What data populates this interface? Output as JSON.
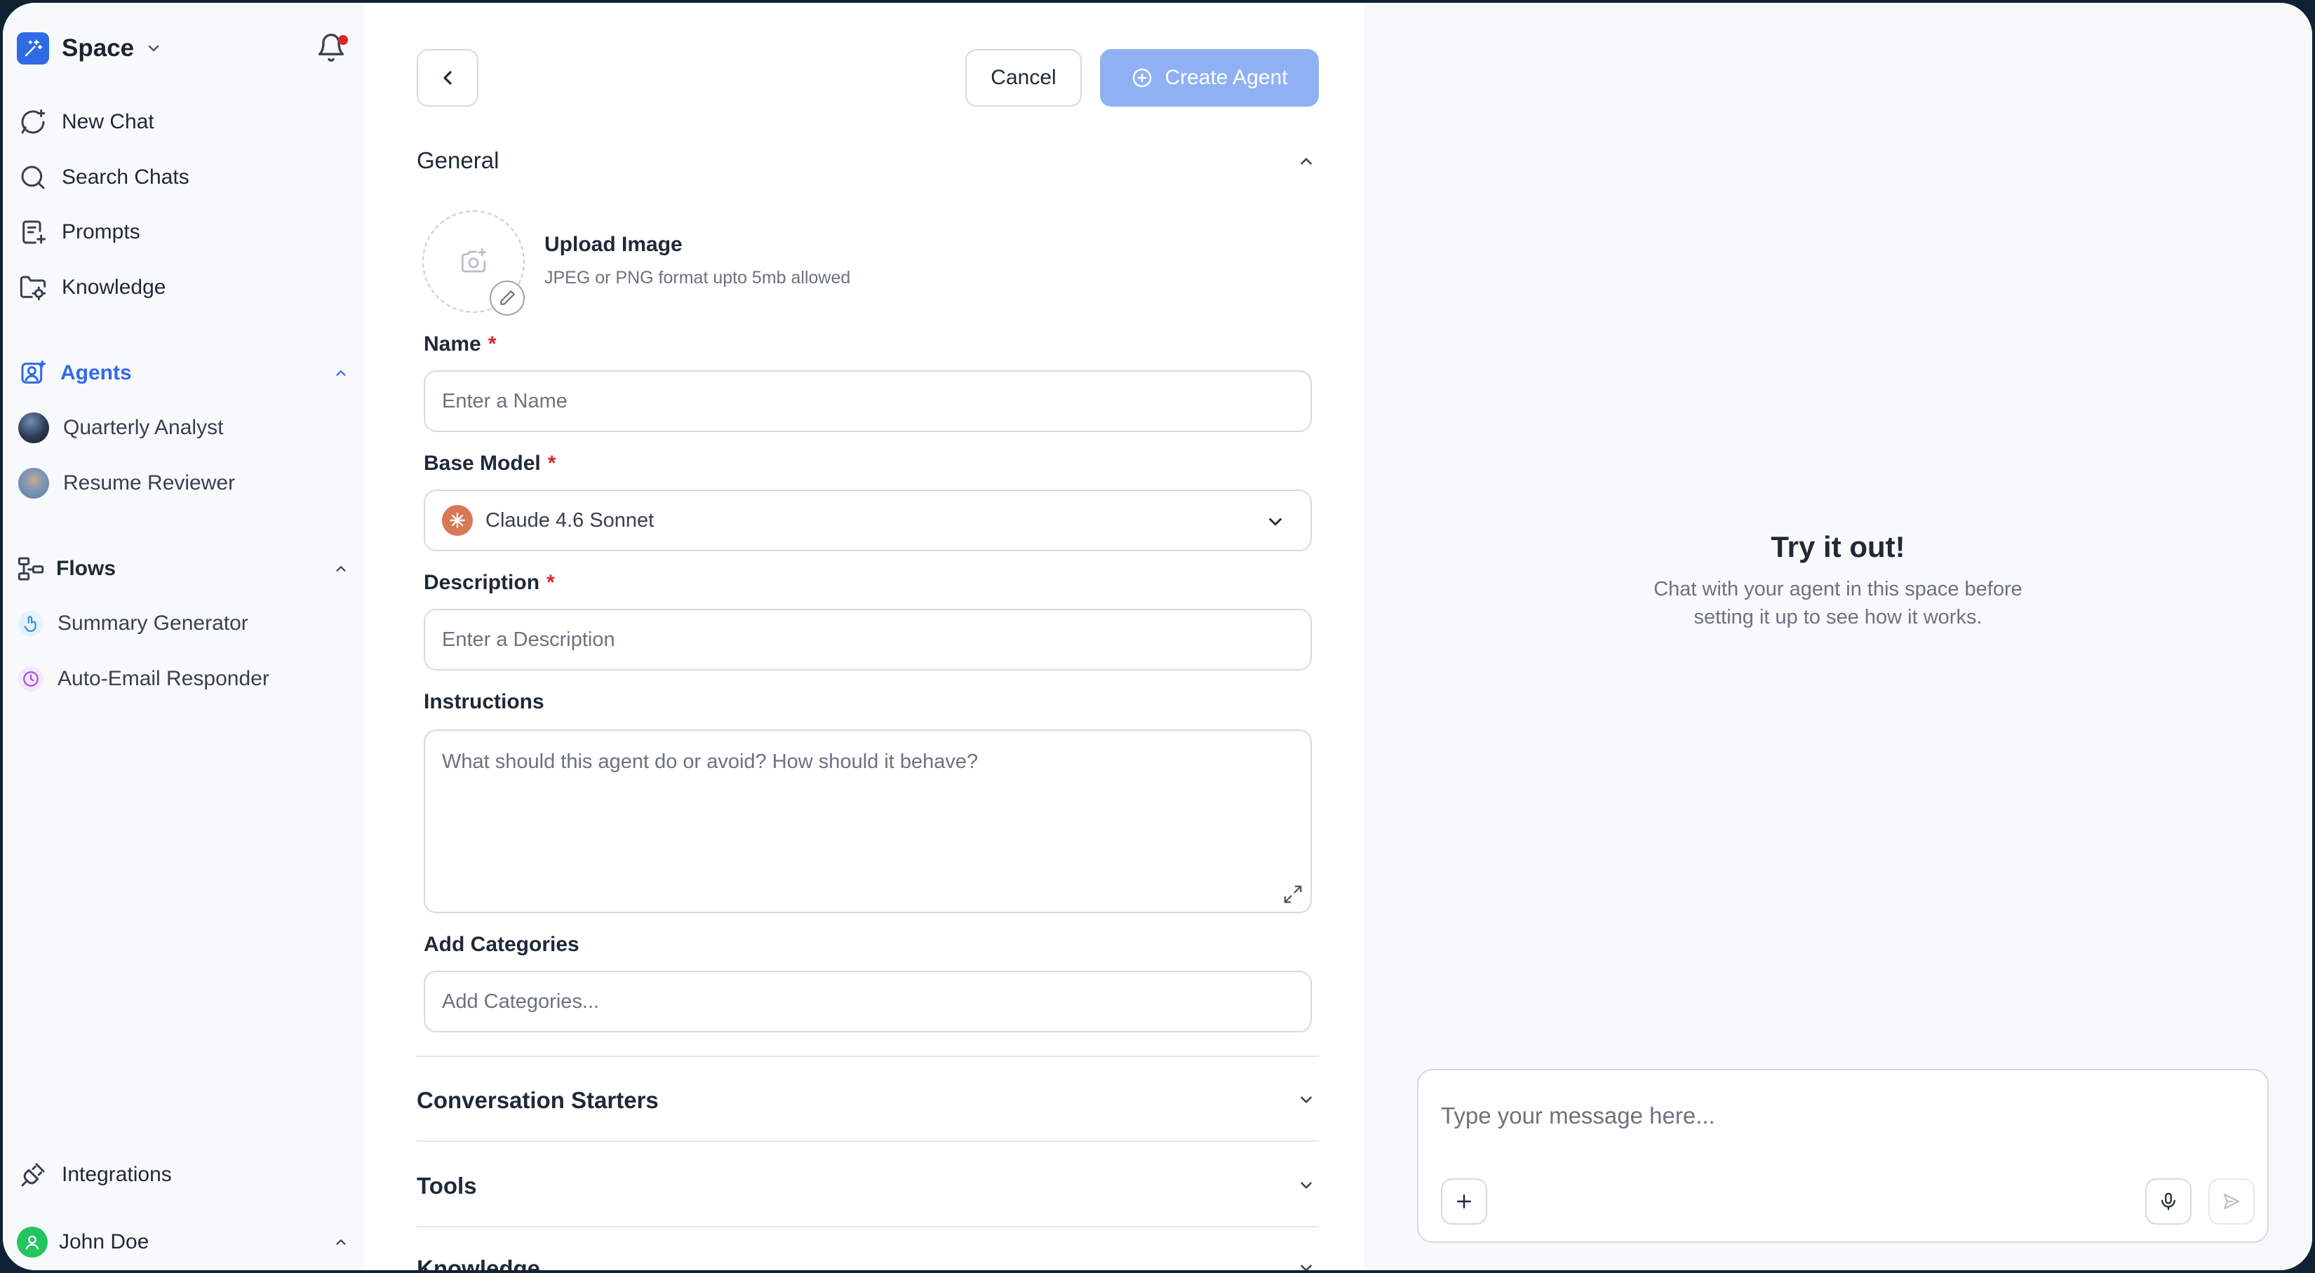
{
  "workspace": {
    "name": "Space"
  },
  "nav": {
    "new_chat": "New Chat",
    "search_chats": "Search Chats",
    "prompts": "Prompts",
    "knowledge": "Knowledge"
  },
  "agents": {
    "label": "Agents",
    "items": [
      {
        "label": "Quarterly Analyst"
      },
      {
        "label": "Resume Reviewer"
      }
    ]
  },
  "flows": {
    "label": "Flows",
    "items": [
      {
        "label": "Summary Generator"
      },
      {
        "label": "Auto-Email Responder"
      }
    ]
  },
  "footer": {
    "integrations": "Integrations",
    "user_name": "John Doe"
  },
  "toolbar": {
    "cancel_label": "Cancel",
    "create_label": "Create Agent"
  },
  "form": {
    "general_title": "General",
    "upload_title": "Upload Image",
    "upload_hint": "JPEG or PNG format upto 5mb allowed",
    "name_label": "Name",
    "name_placeholder": "Enter a Name",
    "base_model_label": "Base Model",
    "base_model_value": "Claude 4.6 Sonnet",
    "description_label": "Description",
    "description_placeholder": "Enter a Description",
    "instructions_label": "Instructions",
    "instructions_placeholder": "What should this agent do or avoid? How should it behave?",
    "categories_label": "Add Categories",
    "categories_placeholder": "Add Categories...",
    "required_mark": "*",
    "conversation_starters_title": "Conversation Starters",
    "tools_title": "Tools",
    "knowledge_title": "Knowledge"
  },
  "preview": {
    "title": "Try it out!",
    "subtitle": "Chat with your agent in this space before setting it up to see how it works.",
    "composer_placeholder": "Type your message here..."
  },
  "colors": {
    "accent": "#2f6be6",
    "create_button": "#8fb1f3",
    "required": "#dc2626",
    "model_brand": "#d97757",
    "notification": "#dc2626"
  },
  "icons": {
    "workspace": "sparkle-logo-icon",
    "bell": "bell-icon",
    "new_chat": "chat-plus-icon",
    "search": "search-icon",
    "prompts": "prompt-doc-icon",
    "knowledge": "folder-gear-icon",
    "agents": "agent-icon",
    "flows": "flow-icon",
    "integrations": "plug-icon",
    "back": "chevron-left-icon",
    "create": "plus-circle-icon",
    "upload": "camera-plus-icon",
    "edit": "pencil-icon",
    "expand": "expand-icon",
    "mic": "mic-icon",
    "send": "send-icon",
    "attach": "plus-icon"
  }
}
